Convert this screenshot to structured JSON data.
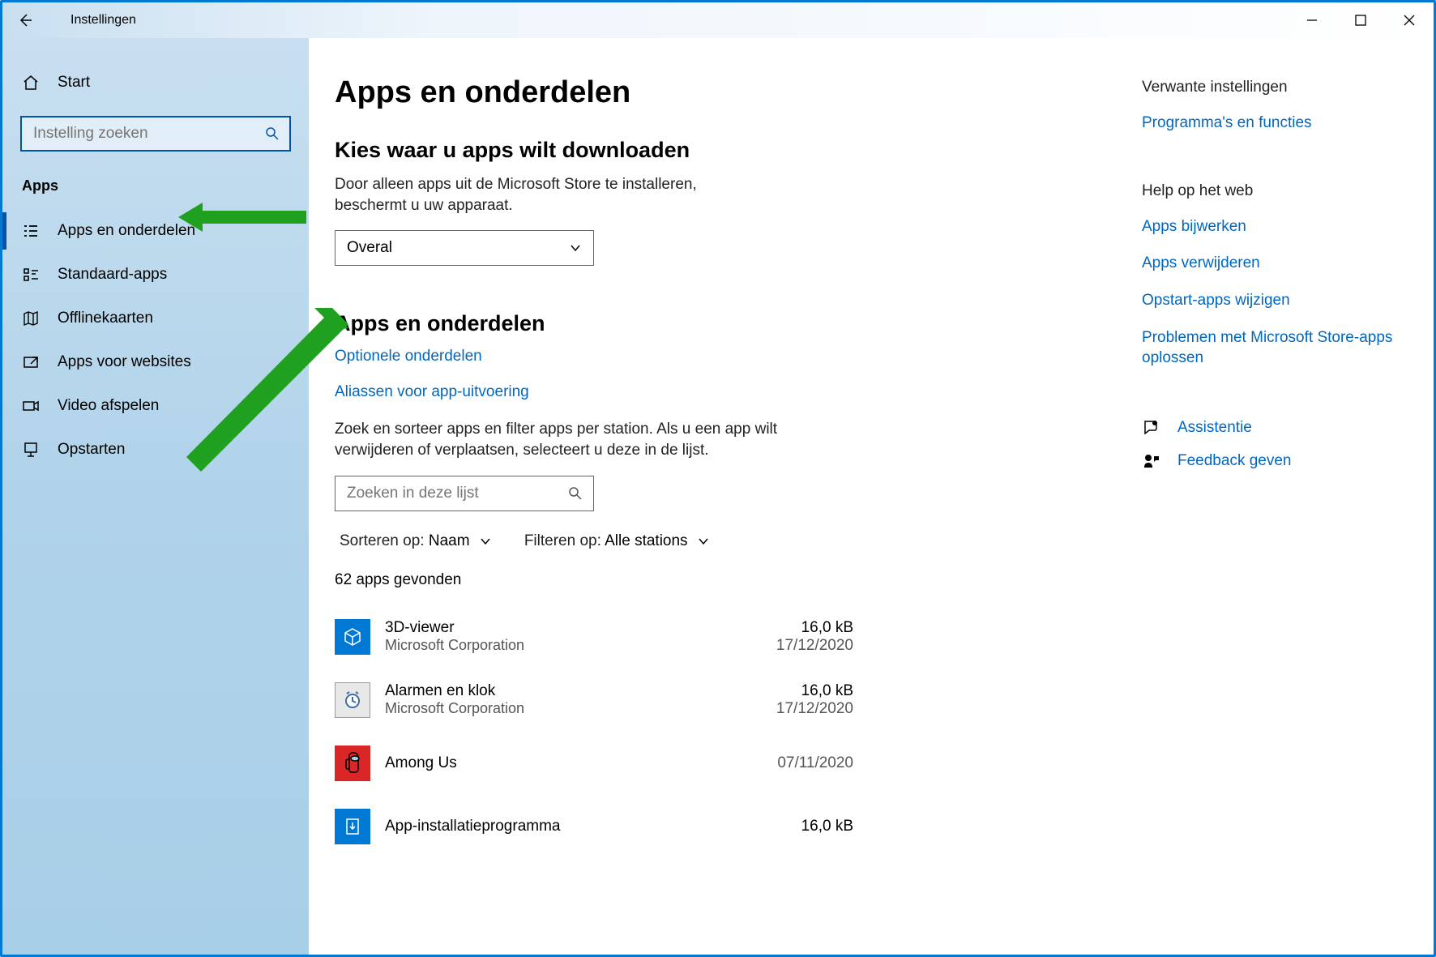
{
  "titlebar": {
    "title": "Instellingen"
  },
  "sidebar": {
    "home": "Start",
    "search_placeholder": "Instelling zoeken",
    "section": "Apps",
    "items": [
      {
        "label": "Apps en onderdelen"
      },
      {
        "label": "Standaard-apps"
      },
      {
        "label": "Offlinekaarten"
      },
      {
        "label": "Apps voor websites"
      },
      {
        "label": "Video afspelen"
      },
      {
        "label": "Opstarten"
      }
    ]
  },
  "main": {
    "h1": "Apps en onderdelen",
    "download_h2": "Kies waar u apps wilt downloaden",
    "download_desc": "Door alleen apps uit de Microsoft Store te installeren, beschermt u uw apparaat.",
    "download_value": "Overal",
    "apps_h2": "Apps en onderdelen",
    "link_optional": "Optionele onderdelen",
    "link_aliases": "Aliassen voor app-uitvoering",
    "apps_desc": "Zoek en sorteer apps en filter apps per station. Als u een app wilt verwijderen of verplaatsen, selecteert u deze in de lijst.",
    "search_list_placeholder": "Zoeken in deze lijst",
    "sort_label": "Sorteren op:",
    "sort_value": "Naam",
    "filter_label": "Filteren op:",
    "filter_value": "Alle stations",
    "count": "62 apps gevonden",
    "apps": [
      {
        "name": "3D-viewer",
        "publisher": "Microsoft Corporation",
        "size": "16,0 kB",
        "date": "17/12/2020"
      },
      {
        "name": "Alarmen en klok",
        "publisher": "Microsoft Corporation",
        "size": "16,0 kB",
        "date": "17/12/2020"
      },
      {
        "name": "Among Us",
        "publisher": "",
        "size": "",
        "date": "07/11/2020"
      },
      {
        "name": "App-installatieprogramma",
        "publisher": "",
        "size": "16,0 kB",
        "date": ""
      }
    ]
  },
  "right": {
    "related_h": "Verwante instellingen",
    "related_link": "Programma's en functies",
    "help_h": "Help op het web",
    "help_links": [
      "Apps bijwerken",
      "Apps verwijderen",
      "Opstart-apps wijzigen",
      "Problemen met Microsoft Store-apps oplossen"
    ],
    "assist": "Assistentie",
    "feedback": "Feedback geven"
  }
}
